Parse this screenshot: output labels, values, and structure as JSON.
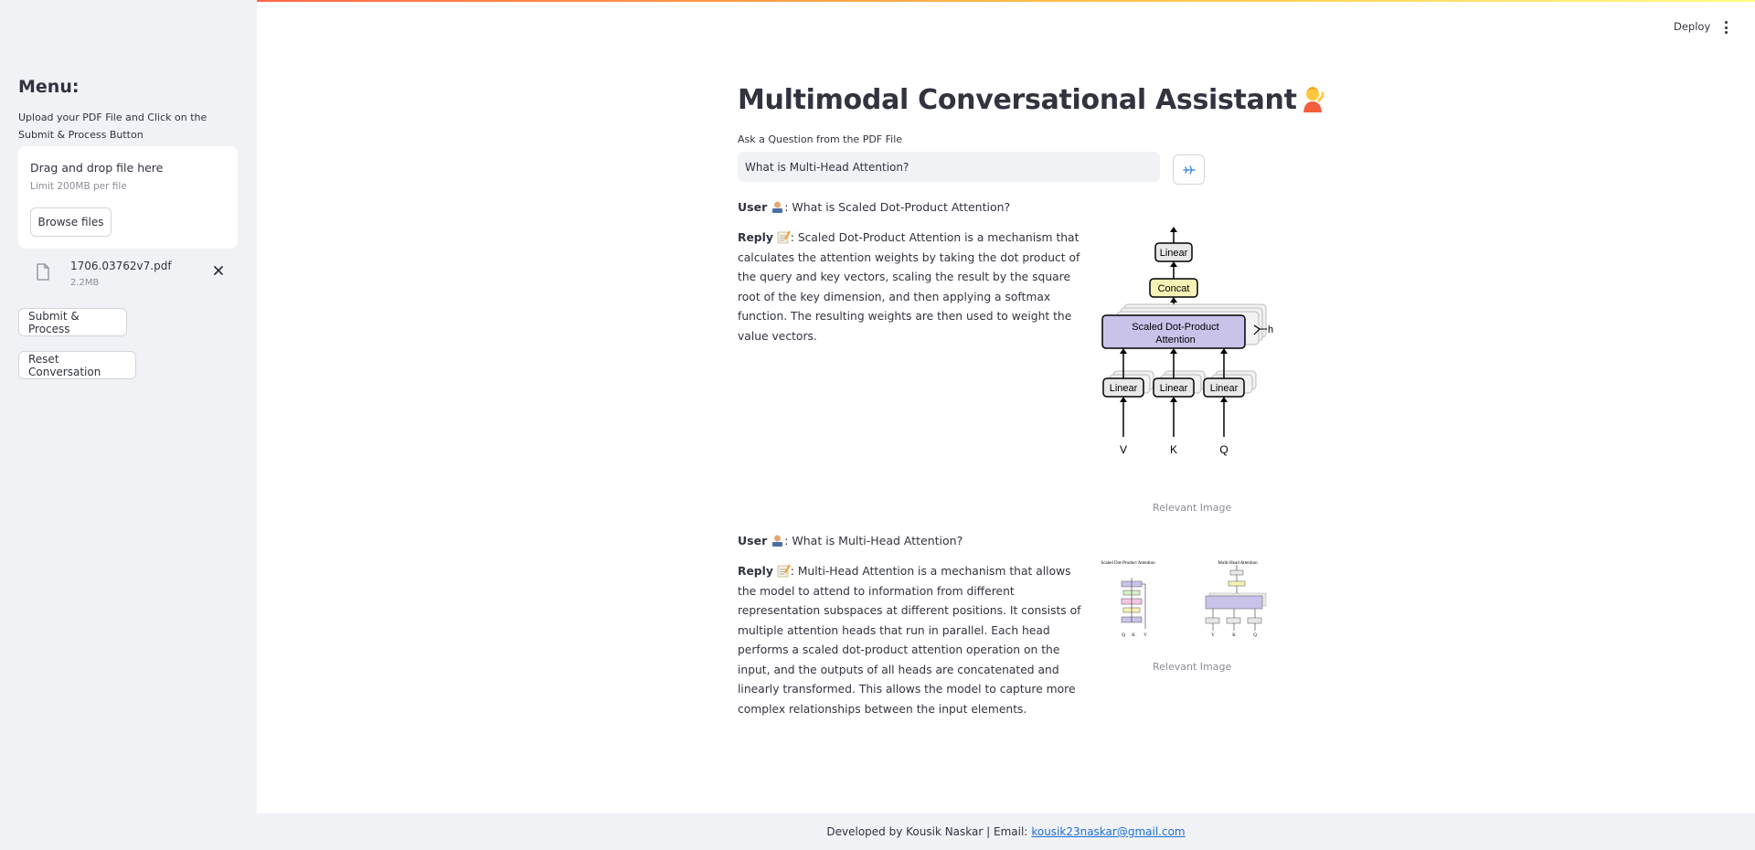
{
  "sidebar": {
    "heading": "Menu:",
    "instruction": "Upload your PDF File and Click on the Submit & Process Button",
    "uploader": {
      "title": "Drag and drop file here",
      "limit": "Limit 200MB per file",
      "browse_label": "Browse files"
    },
    "file": {
      "name": "1706.03762v7.pdf",
      "size": "2.2MB"
    },
    "submit_label": "Submit & Process",
    "reset_label": "Reset Conversation"
  },
  "header": {
    "deploy_label": "Deploy"
  },
  "main": {
    "title": "Multimodal Conversational Assistant",
    "question_label": "Ask a Question from the PDF File",
    "question_value": "What is Multi-Head Attention?",
    "conversation": [
      {
        "user_prefix": "User",
        "user_text": ": What is Scaled Dot-Product Attention?",
        "reply_prefix": "Reply",
        "reply_text": ": Scaled Dot-Product Attention is a mechanism that calculates the attention weights by taking the dot product of the query and key vectors, scaling the result by the square root of the key dimension, and then applying a softmax function. The resulting weights are then used to weight the value vectors.",
        "image_caption": "Relevant Image",
        "diagram": {
          "linear_top": "Linear",
          "concat": "Concat",
          "attention_line1": "Scaled Dot-Product",
          "attention_line2": "Attention",
          "h": "h",
          "linear_v": "Linear",
          "linear_k": "Linear",
          "linear_q": "Linear",
          "v": "V",
          "k": "K",
          "q": "Q"
        }
      },
      {
        "user_prefix": "User",
        "user_text": ": What is Multi-Head Attention?",
        "reply_prefix": "Reply",
        "reply_text": ": Multi-Head Attention is a mechanism that allows the model to attend to information from different representation subspaces at different positions. It consists of multiple attention heads that run in parallel. Each head performs a scaled dot-product attention operation on the input, and the outputs of all heads are concatenated and linearly transformed. This allows the model to capture more complex relationships between the input elements.",
        "image_caption": "Relevant Image",
        "diagram": {
          "left_title": "Scaled Dot-Product Attention",
          "right_title": "Multi-Head Attention",
          "left_q": "Q",
          "left_k": "K",
          "left_v": "V",
          "right_v": "V",
          "right_k": "K",
          "right_q": "Q"
        }
      }
    ]
  },
  "footer": {
    "text": "Developed by Kousik Naskar | Email:",
    "email": "kousik23naskar@gmail.com"
  }
}
